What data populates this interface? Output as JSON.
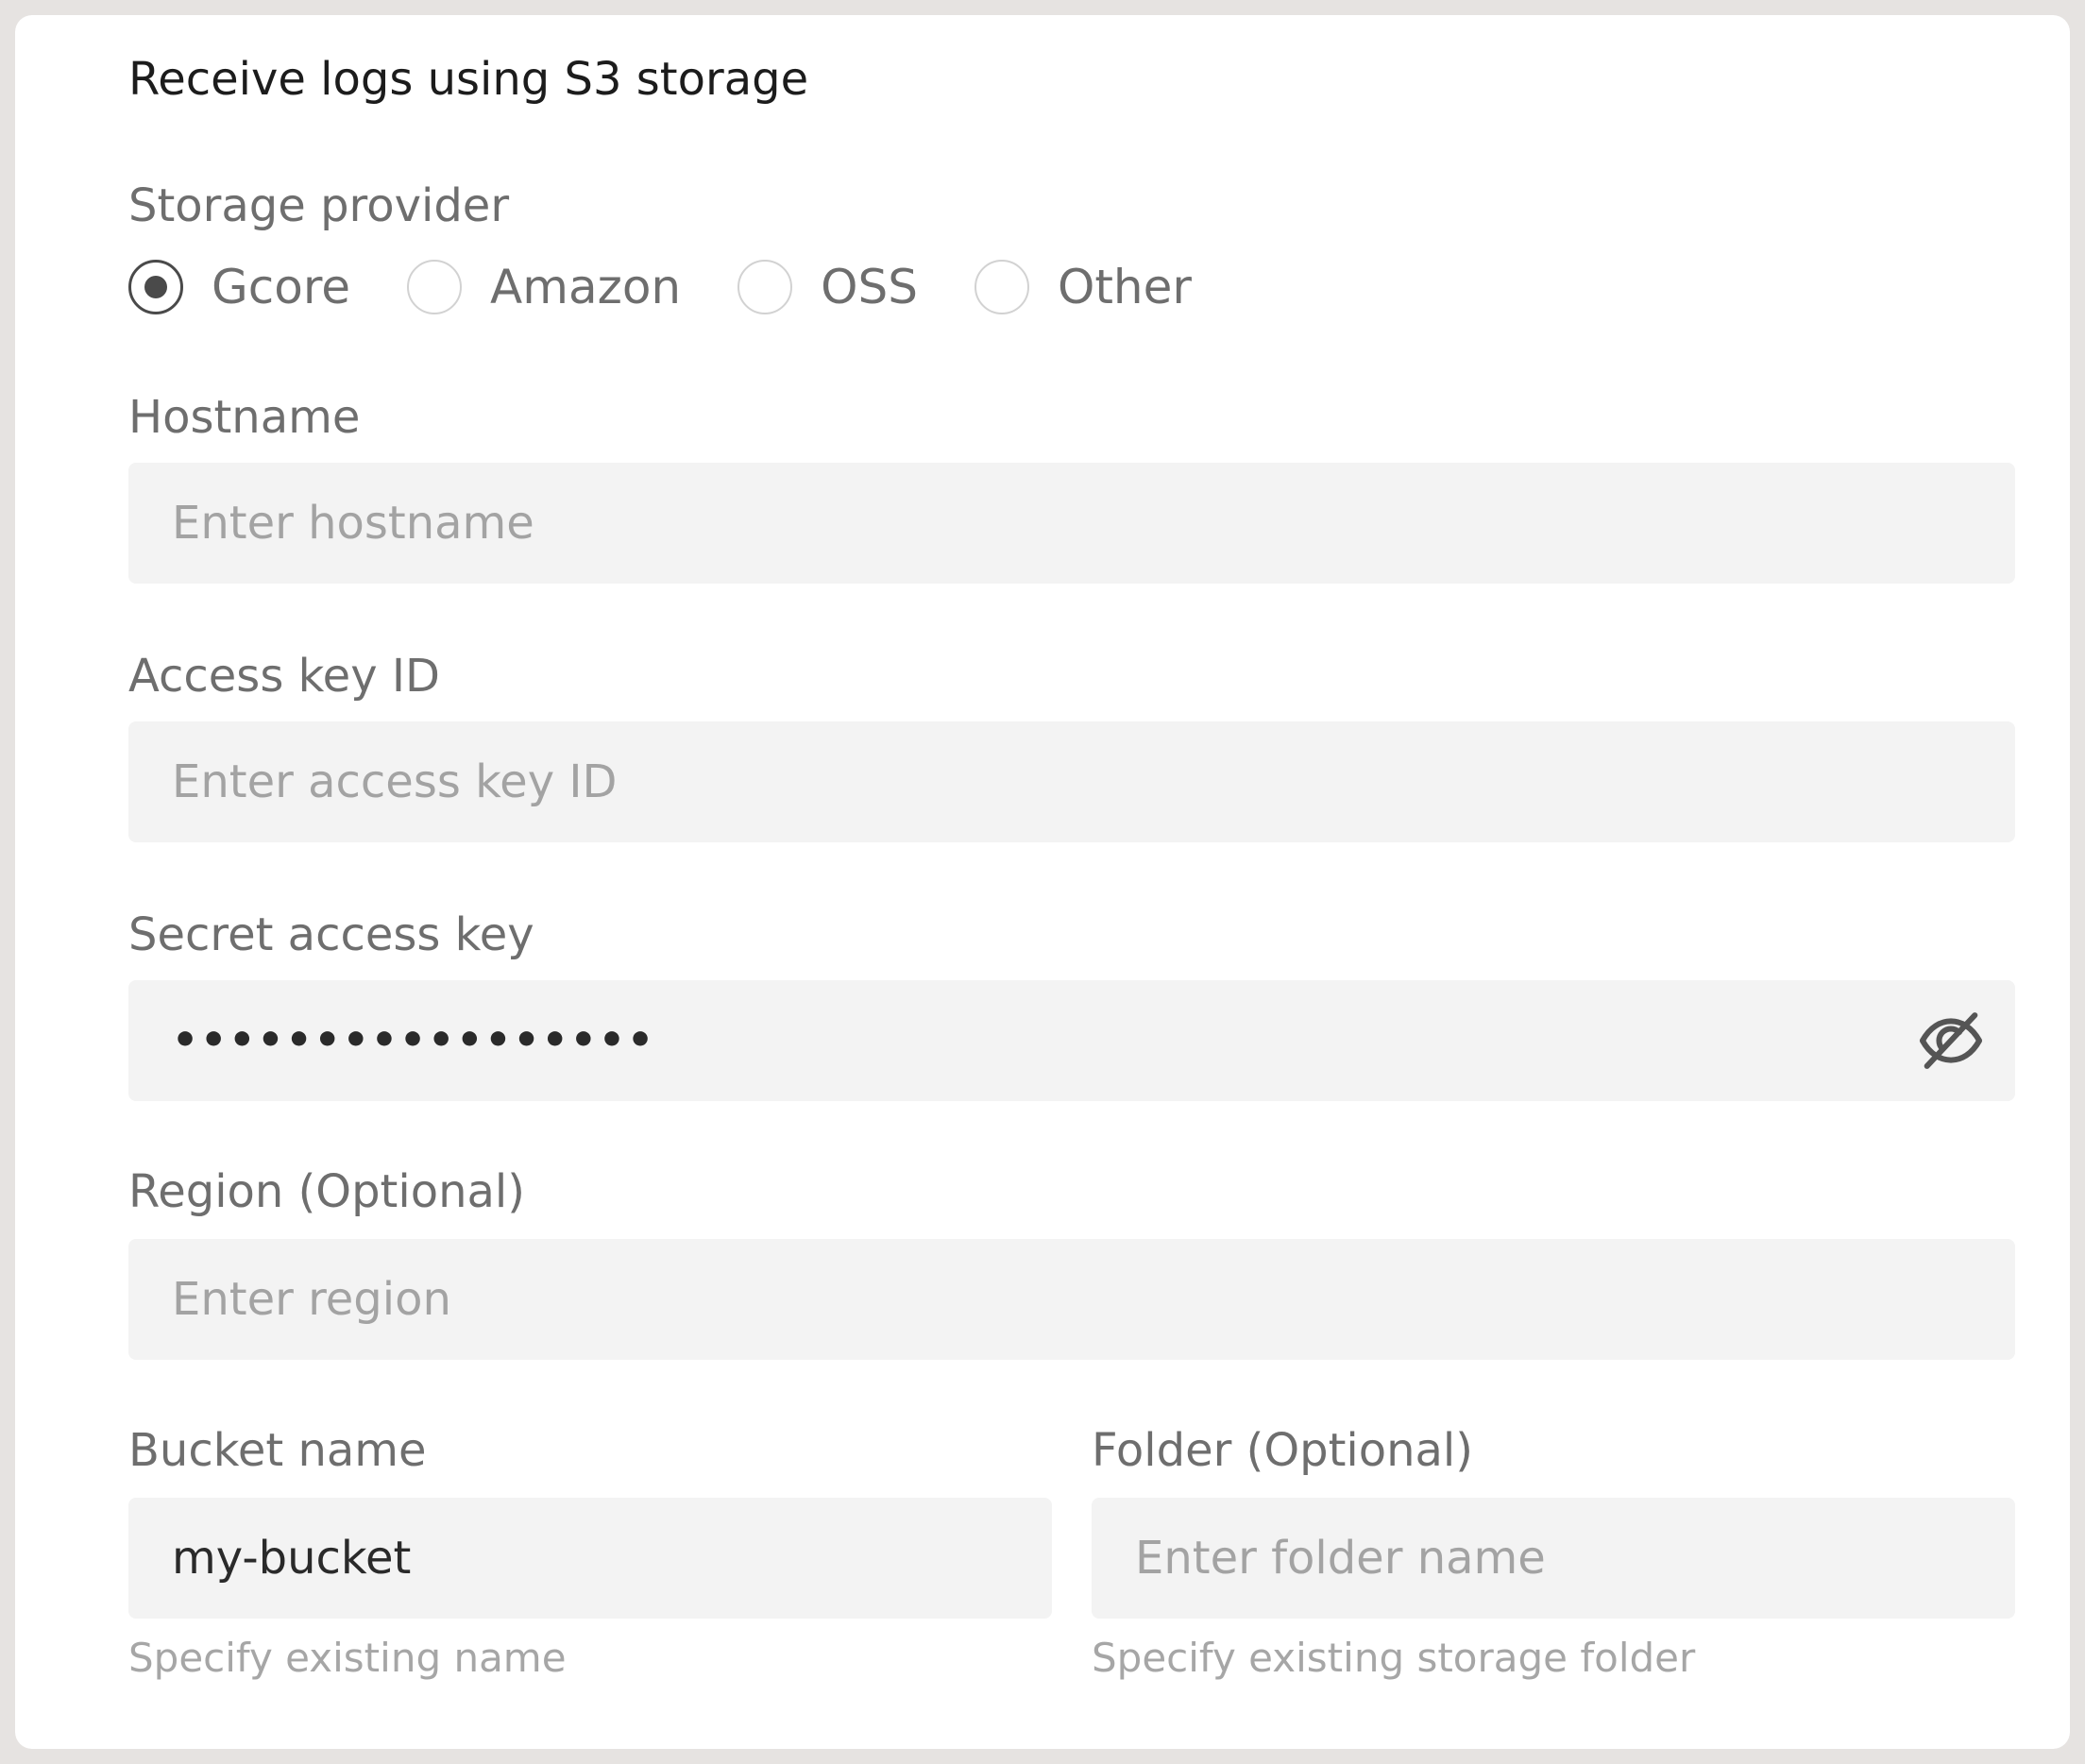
{
  "section": {
    "title": "Receive logs using S3 storage"
  },
  "storage_provider": {
    "label": "Storage provider",
    "options": [
      {
        "label": "Gcore",
        "checked": true
      },
      {
        "label": "Amazon",
        "checked": false
      },
      {
        "label": "OSS",
        "checked": false
      },
      {
        "label": "Other",
        "checked": false
      }
    ],
    "selected": "Gcore"
  },
  "hostname": {
    "label": "Hostname",
    "placeholder": "Enter hostname",
    "value": ""
  },
  "access_key_id": {
    "label": "Access key ID",
    "placeholder": "Enter access key ID",
    "value": ""
  },
  "secret_access_key": {
    "label": "Secret access key",
    "masked_value": "•••••••••••••••••",
    "visibility_icon": "eye-off-icon"
  },
  "region": {
    "label": "Region (Optional)",
    "placeholder": "Enter region",
    "value": ""
  },
  "bucket_name": {
    "label": "Bucket name",
    "value": "my-bucket",
    "hint": "Specify existing name"
  },
  "folder": {
    "label": "Folder (Optional)",
    "placeholder": "Enter folder name",
    "value": "",
    "hint": "Specify existing storage folder"
  },
  "colors": {
    "page_background": "#e6e3e1",
    "card_background": "#ffffff",
    "field_background": "#f3f3f3",
    "label_text": "#6e6e6e",
    "placeholder_text": "#a3a3a3",
    "hint_text": "#a6a6a6",
    "radio_selected": "#4a4a4a"
  }
}
